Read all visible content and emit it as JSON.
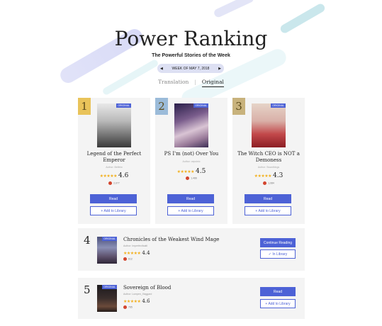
{
  "header": {
    "title": "Power Ranking",
    "subtitle": "The Powerful Stories of the Week",
    "week_label": "WEEK OF MAY 7, 2018",
    "prev_arrow": "◀",
    "next_arrow": "▶"
  },
  "tabs": [
    {
      "label": "Translation",
      "active": false
    },
    {
      "label": "Original",
      "active": true
    }
  ],
  "tab_separator": "|",
  "badge_label": "ORIGINAL",
  "colors": {
    "accent": "#4d62d6",
    "rank1": "#e9c35a",
    "rank2": "#9bbbd9",
    "rank3": "#c8b27c",
    "star": "#f2b01e"
  },
  "top_books": [
    {
      "rank": "1",
      "title": "Legend of the Perfect Emperor",
      "author": "Author: Beifeiw",
      "stars": "★★★★★",
      "rating": "4.6",
      "votes": "2,077",
      "read_label": "Read",
      "library_label": "+ Add to Library"
    },
    {
      "rank": "2",
      "title": "PS I'm (not) Over You",
      "author": "Author: cepulnic",
      "stars": "★★★★★",
      "rating": "4.5",
      "votes": "1,466",
      "read_label": "Read",
      "library_label": "+ Add to Library"
    },
    {
      "rank": "3",
      "title": "The Witch CEO is NOT a Demoness",
      "author": "Author: Swanthings",
      "stars": "★★★★★",
      "rating": "4.3",
      "votes": "1,084",
      "read_label": "Read",
      "library_label": "+ Add to Library"
    }
  ],
  "list_books": [
    {
      "rank": "4",
      "title": "Chronicles of the Weakest Wind Mage",
      "author": "Author: ImperfectIsaiti",
      "stars": "★★★★★",
      "rating": "4.4",
      "votes": "612",
      "primary_label": "Continue Reading",
      "secondary_label": "✓ In Library"
    },
    {
      "rank": "5",
      "title": "Sovereign of Blood",
      "author": "Author: Lumpen_Haggard",
      "stars": "★★★★★",
      "rating": "4.6",
      "votes": "765",
      "primary_label": "Read",
      "secondary_label": "+ Add to Library"
    }
  ]
}
